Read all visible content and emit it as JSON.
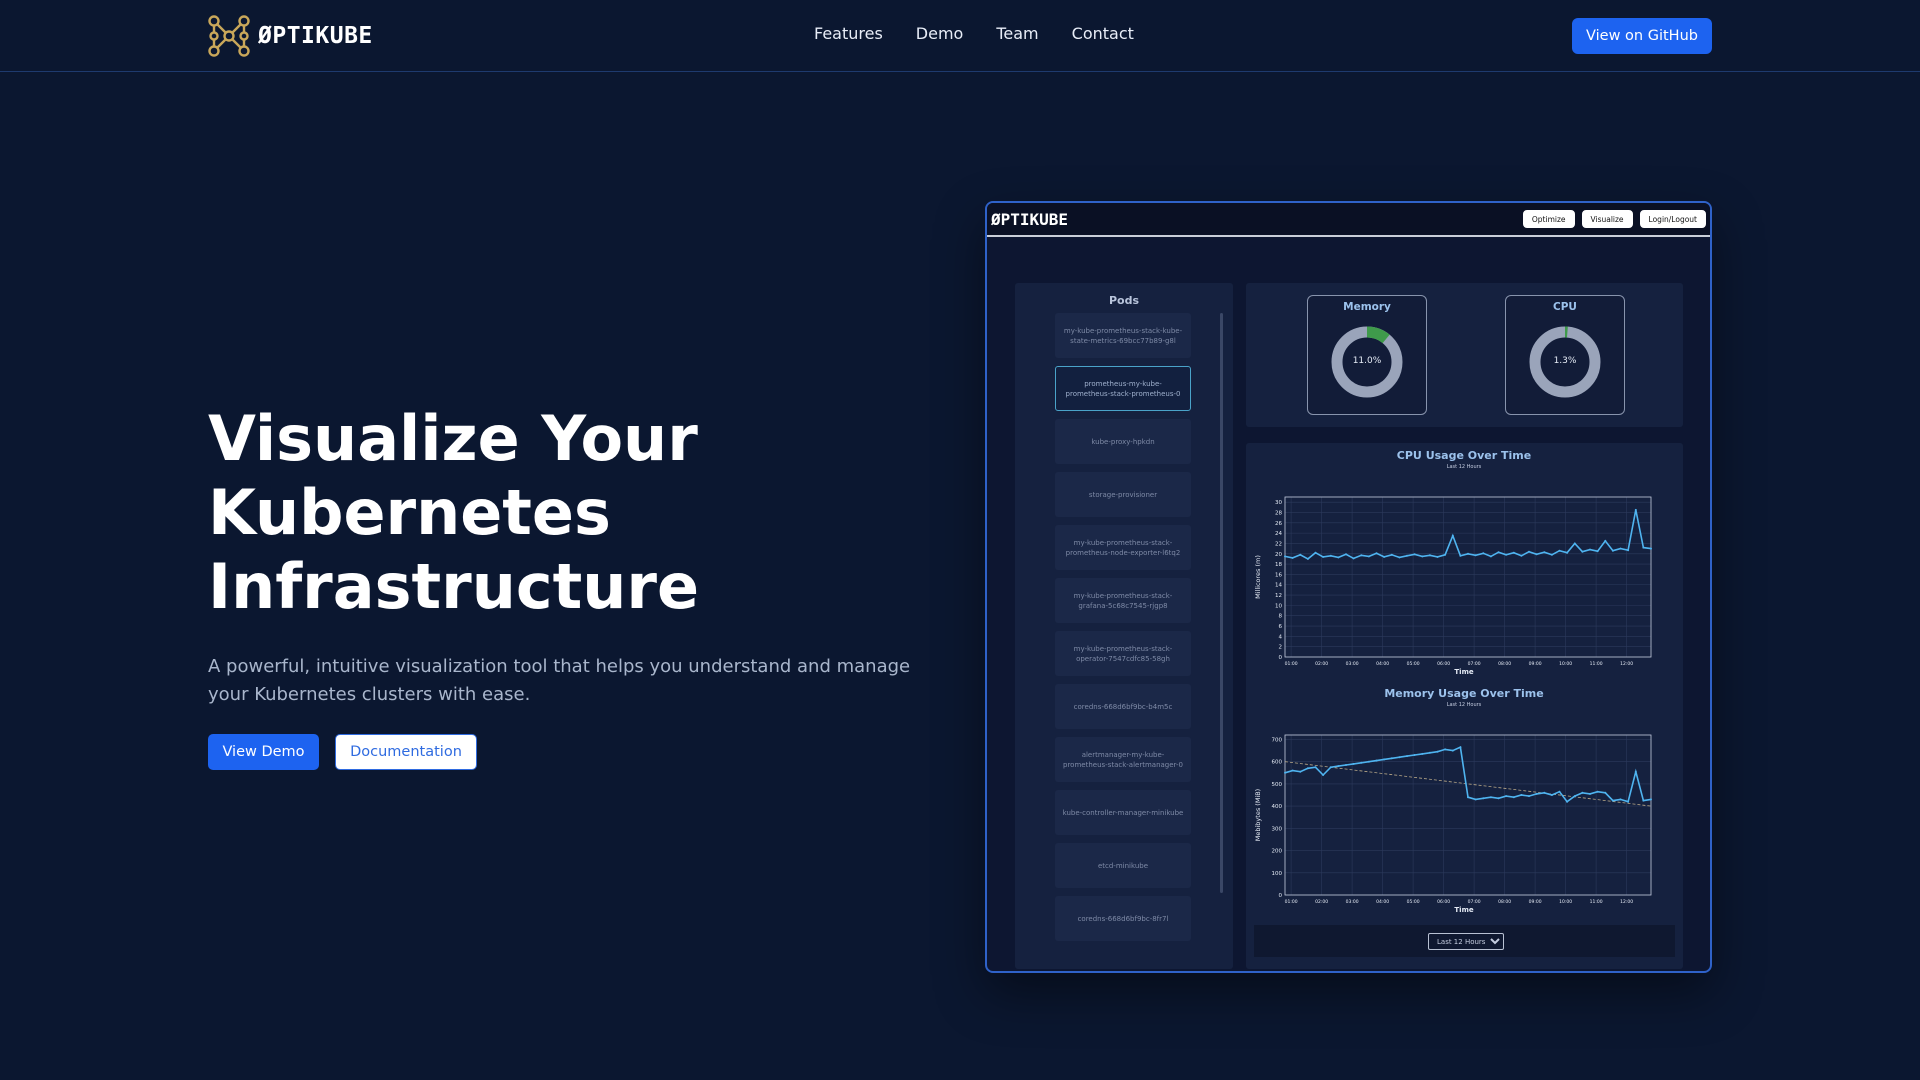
{
  "header": {
    "brand": "ØPTIKUBE",
    "nav": [
      "Features",
      "Demo",
      "Team",
      "Contact"
    ],
    "github_label": "View on GitHub"
  },
  "hero": {
    "title_lines": [
      "Visualize Your",
      "Kubernetes",
      "Infrastructure"
    ],
    "subtitle_lines": [
      "A powerful, intuitive visualization tool that helps you understand and manage",
      "your Kubernetes clusters with ease."
    ],
    "demo_label": "View Demo",
    "docs_label": "Documentation"
  },
  "preview": {
    "app_logo": "ØPTIKUBE",
    "toolbar": [
      "Optimize",
      "Visualize",
      "Login/Logout"
    ],
    "pods_title": "Pods",
    "pods": [
      "my-kube-prometheus-stack-kube-state-metrics-69bcc77b89-g8l",
      "prometheus-my-kube-prometheus-stack-prometheus-0",
      "kube-proxy-hpkdn",
      "storage-provisioner",
      "my-kube-prometheus-stack-prometheus-node-exporter-l6tq2",
      "my-kube-prometheus-stack-grafana-5c68c7545-rjgp8",
      "my-kube-prometheus-stack-operator-7547cdfc85-58gh",
      "coredns-668d6bf9bc-b4m5c",
      "alertmanager-my-kube-prometheus-stack-alertmanager-0",
      "kube-controller-manager-minikube",
      "etcd-minikube",
      "coredns-668d6bf9bc-8fr7l"
    ],
    "selected_pod_index": 1,
    "gauges": {
      "memory": {
        "label": "Memory",
        "value": "11.0%",
        "fraction": 0.11
      },
      "cpu": {
        "label": "CPU",
        "value": "1.3%",
        "fraction": 0.013
      }
    },
    "time_range": "Last 12 Hours",
    "colors": {
      "accent": "#1d63f0",
      "line": "#4fb4f0",
      "used": "#3f9a4b",
      "free": "#9aa4ba"
    }
  },
  "chart_data": [
    {
      "type": "line",
      "title": "CPU Usage Over Time",
      "subtitle": "Last 12 Hours",
      "xlabel": "Time",
      "ylabel": "Millicores (m)",
      "ylim": [
        0,
        31
      ],
      "yticks": [
        0,
        2,
        4,
        6,
        8,
        10,
        12,
        14,
        16,
        18,
        20,
        22,
        24,
        26,
        28,
        30
      ],
      "x_tick_labels": [
        "01:00",
        "02:00",
        "03:00",
        "04:00",
        "05:00",
        "06:00",
        "07:00",
        "08:00",
        "09:00",
        "10:00",
        "11:00",
        "12:00"
      ],
      "grid": true,
      "x": [
        0.0,
        0.25,
        0.5,
        0.75,
        1.0,
        1.25,
        1.5,
        1.75,
        2.0,
        2.25,
        2.5,
        2.75,
        3.0,
        3.25,
        3.5,
        3.75,
        4.0,
        4.25,
        4.5,
        4.75,
        5.0,
        5.25,
        5.5,
        5.75,
        6.0,
        6.25,
        6.5,
        6.75,
        7.0,
        7.25,
        7.5,
        7.75,
        8.0,
        8.25,
        8.5,
        8.75,
        9.0,
        9.25,
        9.5,
        9.75,
        10.0,
        10.25,
        10.5,
        10.75,
        11.0,
        11.25,
        11.5,
        11.75,
        12.0
      ],
      "series": [
        {
          "values": [
            19.5,
            19.2,
            19.8,
            19.0,
            20.2,
            19.4,
            19.6,
            19.3,
            19.9,
            19.1,
            19.7,
            19.5,
            20.1,
            19.4,
            19.8,
            19.3,
            19.6,
            19.9,
            19.5,
            19.7,
            19.4,
            19.8,
            23.5,
            19.6,
            20.0,
            19.7,
            20.1,
            19.5,
            20.3,
            19.8,
            20.2,
            19.6,
            20.4,
            19.9,
            20.3,
            19.8,
            20.6,
            20.2,
            22.0,
            20.4,
            20.8,
            20.5,
            22.5,
            20.6,
            21.0,
            20.7,
            28.5,
            21.2,
            21.0
          ]
        }
      ]
    },
    {
      "type": "line",
      "title": "Memory Usage Over Time",
      "subtitle": "Last 12 Hours",
      "xlabel": "Time",
      "ylabel": "Mebibytes (MiB)",
      "ylim": [
        0,
        720
      ],
      "yticks": [
        0,
        100,
        200,
        300,
        400,
        500,
        600,
        700
      ],
      "x_tick_labels": [
        "01:00",
        "02:00",
        "03:00",
        "04:00",
        "05:00",
        "06:00",
        "07:00",
        "08:00",
        "09:00",
        "10:00",
        "11:00",
        "12:00"
      ],
      "grid": true,
      "trendline": [
        600,
        400
      ],
      "x": [
        0.0,
        0.25,
        0.5,
        0.75,
        1.0,
        1.25,
        1.5,
        1.75,
        2.0,
        2.25,
        2.5,
        2.75,
        3.0,
        3.25,
        3.5,
        3.75,
        4.0,
        4.25,
        4.5,
        4.75,
        5.0,
        5.25,
        5.5,
        5.75,
        6.0,
        6.25,
        6.5,
        6.75,
        7.0,
        7.25,
        7.5,
        7.75,
        8.0,
        8.25,
        8.5,
        8.75,
        9.0,
        9.25,
        9.5,
        9.75,
        10.0,
        10.25,
        10.5,
        10.75,
        11.0,
        11.25,
        11.5,
        11.75,
        12.0
      ],
      "series": [
        {
          "values": [
            550,
            560,
            555,
            570,
            575,
            540,
            575,
            580,
            585,
            590,
            595,
            600,
            605,
            610,
            615,
            620,
            625,
            630,
            635,
            640,
            645,
            655,
            650,
            665,
            440,
            430,
            435,
            440,
            435,
            445,
            440,
            450,
            445,
            455,
            460,
            450,
            465,
            420,
            445,
            460,
            455,
            465,
            460,
            425,
            430,
            420,
            555,
            425,
            430
          ]
        }
      ]
    }
  ]
}
